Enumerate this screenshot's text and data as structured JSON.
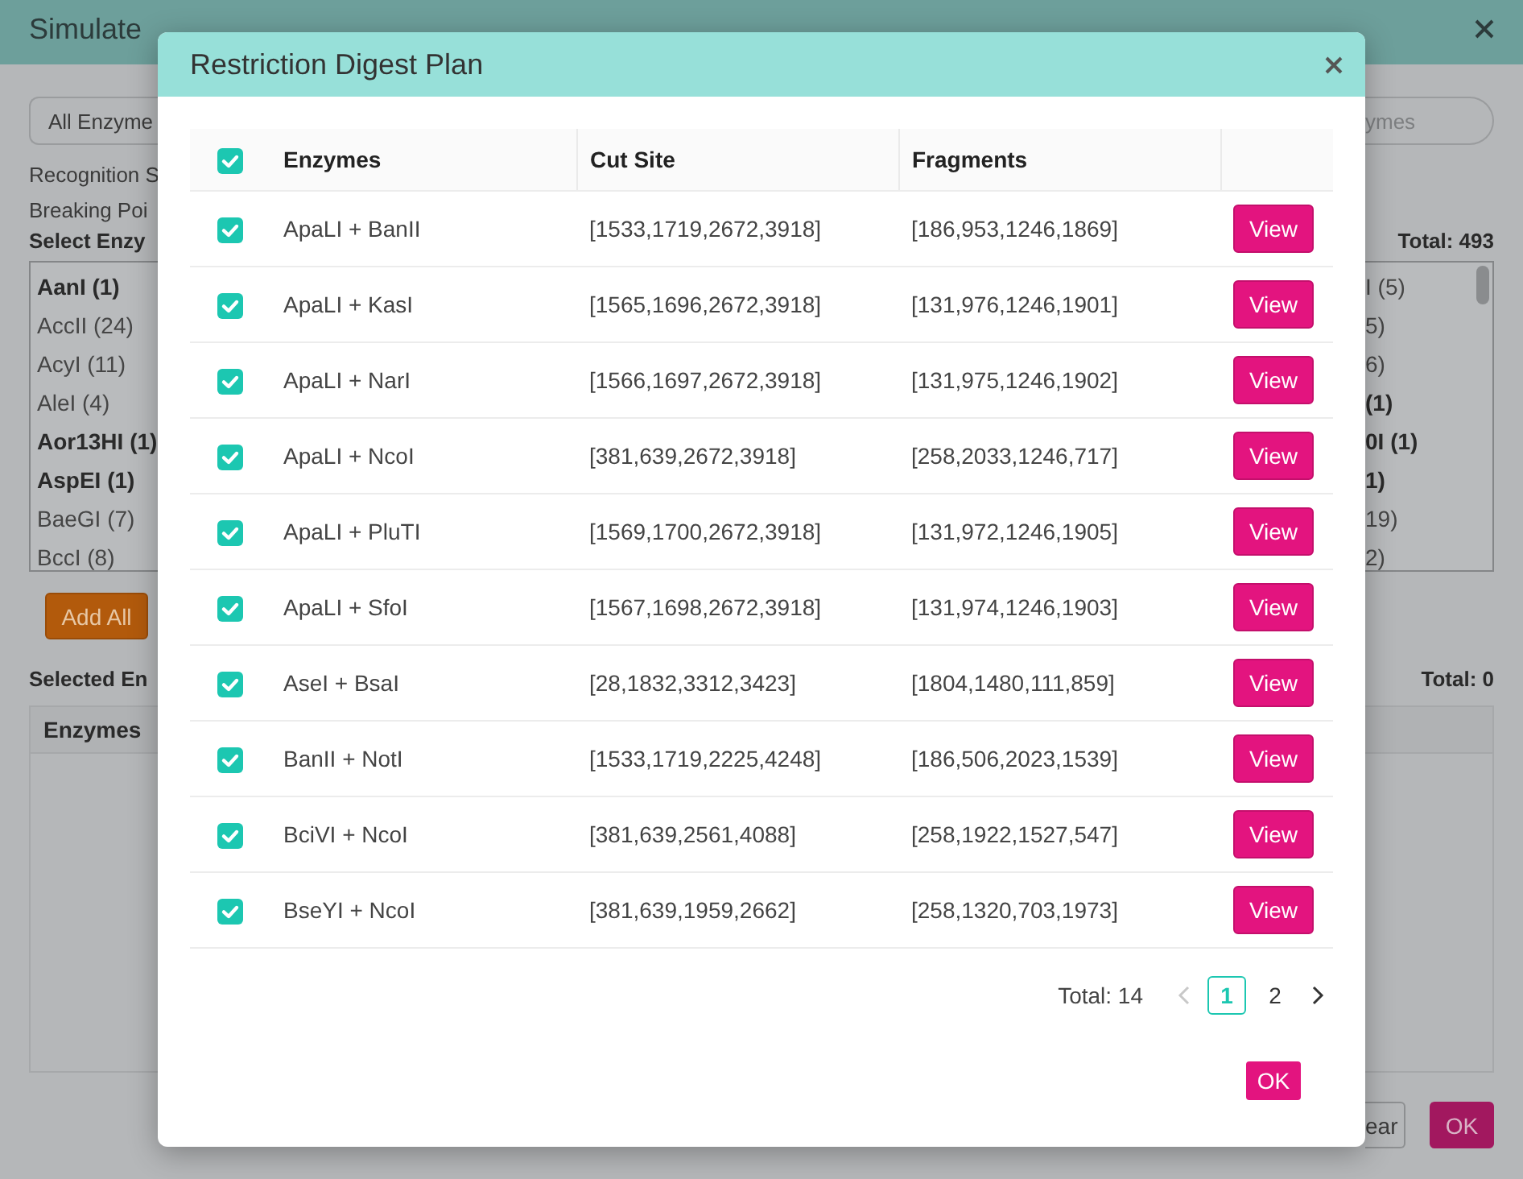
{
  "window": {
    "title": "Simulate"
  },
  "background": {
    "enzyme_filter": {
      "value": "All Enzyme"
    },
    "search": {
      "placeholder": "ymes"
    },
    "recognition_label": "Recognition S",
    "breaking_label": "Breaking Poi",
    "select_heading": "Select Enzy",
    "available_total": "Total: 493",
    "available_left": [
      {
        "label": "AanI (1)",
        "bold": true
      },
      {
        "label": "AccII (24)",
        "bold": false
      },
      {
        "label": "AcyI (11)",
        "bold": false
      },
      {
        "label": "AleI (4)",
        "bold": false
      },
      {
        "label": "Aor13HI (1)",
        "bold": true
      },
      {
        "label": "AspEI (1)",
        "bold": true
      },
      {
        "label": "BaeGI (7)",
        "bold": false
      },
      {
        "label": "BccI (8)",
        "bold": false
      }
    ],
    "available_right": [
      {
        "label": "I (5)",
        "bold": false
      },
      {
        "label": "5)",
        "bold": false
      },
      {
        "label": "6)",
        "bold": false
      },
      {
        "label": "(1)",
        "bold": true
      },
      {
        "label": "0I (1)",
        "bold": true
      },
      {
        "label": "1)",
        "bold": true
      },
      {
        "label": "19)",
        "bold": false
      },
      {
        "label": "2)",
        "bold": false
      }
    ],
    "add_all": "Add All",
    "selected_heading": "Selected En",
    "selected_total": "Total: 0",
    "selected_columns": [
      "Enzymes"
    ],
    "buttons": [
      "ear",
      "OK"
    ]
  },
  "dialog": {
    "title": "Restriction Digest Plan",
    "select_all_checked": true,
    "columns": [
      "Enzymes",
      "Cut Site",
      "Fragments"
    ],
    "rows": [
      {
        "checked": true,
        "enzymes": "ApaLI + BanII",
        "cut_site": "[1533,1719,2672,3918]",
        "fragments": "[186,953,1246,1869]",
        "action": "View"
      },
      {
        "checked": true,
        "enzymes": "ApaLI + KasI",
        "cut_site": "[1565,1696,2672,3918]",
        "fragments": "[131,976,1246,1901]",
        "action": "View"
      },
      {
        "checked": true,
        "enzymes": "ApaLI + NarI",
        "cut_site": "[1566,1697,2672,3918]",
        "fragments": "[131,975,1246,1902]",
        "action": "View"
      },
      {
        "checked": true,
        "enzymes": "ApaLI + NcoI",
        "cut_site": "[381,639,2672,3918]",
        "fragments": "[258,2033,1246,717]",
        "action": "View"
      },
      {
        "checked": true,
        "enzymes": "ApaLI + PluTI",
        "cut_site": "[1569,1700,2672,3918]",
        "fragments": "[131,972,1246,1905]",
        "action": "View"
      },
      {
        "checked": true,
        "enzymes": "ApaLI + SfoI",
        "cut_site": "[1567,1698,2672,3918]",
        "fragments": "[131,974,1246,1903]",
        "action": "View"
      },
      {
        "checked": true,
        "enzymes": "AseI + BsaI",
        "cut_site": "[28,1832,3312,3423]",
        "fragments": "[1804,1480,111,859]",
        "action": "View"
      },
      {
        "checked": true,
        "enzymes": "BanII + NotI",
        "cut_site": "[1533,1719,2225,4248]",
        "fragments": "[186,506,2023,1539]",
        "action": "View"
      },
      {
        "checked": true,
        "enzymes": "BciVI + NcoI",
        "cut_site": "[381,639,2561,4088]",
        "fragments": "[258,1922,1527,547]",
        "action": "View"
      },
      {
        "checked": true,
        "enzymes": "BseYI + NcoI",
        "cut_site": "[381,639,1959,2662]",
        "fragments": "[258,1320,703,1973]",
        "action": "View"
      }
    ],
    "pagination": {
      "total": "Total: 14",
      "prev_disabled": true,
      "pages": [
        {
          "label": "1",
          "selected": true
        },
        {
          "label": "2",
          "selected": false
        }
      ]
    },
    "ok": "OK"
  }
}
